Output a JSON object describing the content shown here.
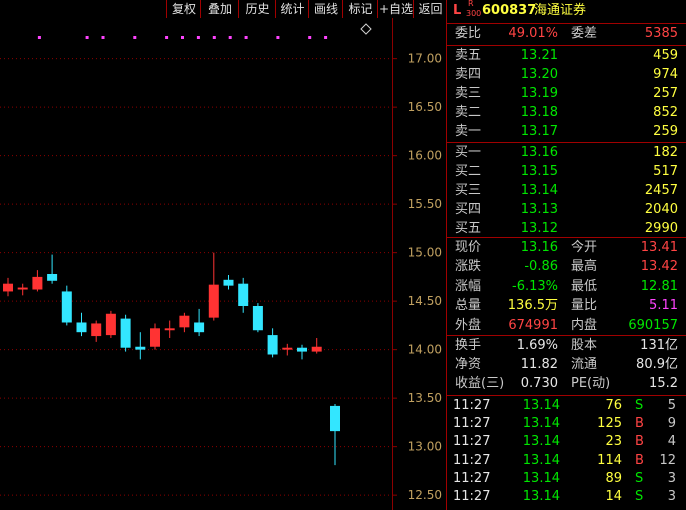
{
  "toolbar": [
    {
      "label": "复权",
      "name": "fuquan-button"
    },
    {
      "label": "叠加",
      "name": "overlay-button"
    },
    {
      "label": "历史",
      "name": "history-button"
    },
    {
      "label": "统计",
      "name": "stats-button"
    },
    {
      "label": "画线",
      "name": "draw-line-button"
    },
    {
      "label": "标记",
      "name": "mark-button"
    },
    {
      "label": "+自选",
      "name": "add-watchlist-button"
    },
    {
      "label": "返回",
      "name": "back-button"
    }
  ],
  "header": {
    "prefix": "L",
    "r_mark": "R",
    "r_sub": "300",
    "code": "600837",
    "name": "海通证券"
  },
  "weibi": {
    "label1": "委比",
    "value1": "49.01%",
    "label2": "委差",
    "value2": "5385"
  },
  "asks": [
    {
      "label": "卖五",
      "price": "13.21",
      "vol": "459"
    },
    {
      "label": "卖四",
      "price": "13.20",
      "vol": "974"
    },
    {
      "label": "卖三",
      "price": "13.19",
      "vol": "257"
    },
    {
      "label": "卖二",
      "price": "13.18",
      "vol": "852"
    },
    {
      "label": "卖一",
      "price": "13.17",
      "vol": "259"
    }
  ],
  "bids": [
    {
      "label": "买一",
      "price": "13.16",
      "vol": "182"
    },
    {
      "label": "买二",
      "price": "13.15",
      "vol": "517"
    },
    {
      "label": "买三",
      "price": "13.14",
      "vol": "2457"
    },
    {
      "label": "买四",
      "price": "13.13",
      "vol": "2040"
    },
    {
      "label": "买五",
      "price": "13.12",
      "vol": "2990"
    }
  ],
  "quote": [
    {
      "l1": "现价",
      "v1": "13.16",
      "c1": "green",
      "l2": "今开",
      "v2": "13.41",
      "c2": "red"
    },
    {
      "l1": "涨跌",
      "v1": "-0.86",
      "c1": "green",
      "l2": "最高",
      "v2": "13.42",
      "c2": "red"
    },
    {
      "l1": "涨幅",
      "v1": "-6.13%",
      "c1": "green",
      "l2": "最低",
      "v2": "12.81",
      "c2": "green"
    },
    {
      "l1": "总量",
      "v1": "136.5万",
      "c1": "yellow",
      "l2": "量比",
      "v2": "5.11",
      "c2": "mag"
    },
    {
      "l1": "外盘",
      "v1": "674991",
      "c1": "red",
      "l2": "内盘",
      "v2": "690157",
      "c2": "green"
    }
  ],
  "fundamentals": [
    {
      "l1": "换手",
      "v1": "1.69%",
      "l2": "股本",
      "v2": "131亿"
    },
    {
      "l1": "净资",
      "v1": "11.82",
      "l2": "流通",
      "v2": "80.9亿"
    },
    {
      "l1": "收益(三)",
      "v1": "0.730",
      "l2": "PE(动)",
      "v2": "15.2"
    }
  ],
  "ticks": [
    {
      "time": "11:27",
      "price": "13.14",
      "vol": "76",
      "side": "S",
      "count": "5"
    },
    {
      "time": "11:27",
      "price": "13.14",
      "vol": "125",
      "side": "B",
      "count": "9"
    },
    {
      "time": "11:27",
      "price": "13.14",
      "vol": "23",
      "side": "B",
      "count": "4"
    },
    {
      "time": "11:27",
      "price": "13.14",
      "vol": "114",
      "side": "B",
      "count": "12"
    },
    {
      "time": "11:27",
      "price": "13.14",
      "vol": "89",
      "side": "S",
      "count": "3"
    },
    {
      "time": "11:27",
      "price": "13.14",
      "vol": "14",
      "side": "S",
      "count": "3"
    }
  ],
  "colors": {
    "up": "#ff3333",
    "down": "#33e6ff",
    "grid": "#8b0000",
    "axis": "#c0a060",
    "marker": "#ff44ff"
  },
  "chart_data": {
    "type": "candlestick",
    "y_ticks": [
      "17.00",
      "16.50",
      "16.00",
      "15.50",
      "15.00",
      "14.50",
      "14.00",
      "13.50",
      "13.00",
      "12.50"
    ],
    "ylim": [
      12.45,
      17.45
    ],
    "candles": [
      {
        "o": 14.6,
        "h": 14.74,
        "l": 14.55,
        "c": 14.68
      },
      {
        "o": 14.62,
        "h": 14.68,
        "l": 14.56,
        "c": 14.64
      },
      {
        "o": 14.62,
        "h": 14.82,
        "l": 14.6,
        "c": 14.75
      },
      {
        "o": 14.78,
        "h": 14.98,
        "l": 14.68,
        "c": 14.71
      },
      {
        "o": 14.6,
        "h": 14.66,
        "l": 14.25,
        "c": 14.28
      },
      {
        "o": 14.28,
        "h": 14.38,
        "l": 14.14,
        "c": 14.18
      },
      {
        "o": 14.14,
        "h": 14.3,
        "l": 14.08,
        "c": 14.27
      },
      {
        "o": 14.15,
        "h": 14.4,
        "l": 14.12,
        "c": 14.37
      },
      {
        "o": 14.32,
        "h": 14.36,
        "l": 13.98,
        "c": 14.02
      },
      {
        "o": 14.03,
        "h": 14.18,
        "l": 13.9,
        "c": 14.0
      },
      {
        "o": 14.03,
        "h": 14.27,
        "l": 14.0,
        "c": 14.22
      },
      {
        "o": 14.2,
        "h": 14.3,
        "l": 14.12,
        "c": 14.22
      },
      {
        "o": 14.23,
        "h": 14.38,
        "l": 14.18,
        "c": 14.35
      },
      {
        "o": 14.28,
        "h": 14.42,
        "l": 14.14,
        "c": 14.18
      },
      {
        "o": 14.33,
        "h": 15.0,
        "l": 14.3,
        "c": 14.67
      },
      {
        "o": 14.72,
        "h": 14.77,
        "l": 14.62,
        "c": 14.66
      },
      {
        "o": 14.68,
        "h": 14.74,
        "l": 14.38,
        "c": 14.45
      },
      {
        "o": 14.45,
        "h": 14.48,
        "l": 14.18,
        "c": 14.2
      },
      {
        "o": 14.15,
        "h": 14.22,
        "l": 13.92,
        "c": 13.95
      },
      {
        "o": 14.0,
        "h": 14.06,
        "l": 13.94,
        "c": 14.02
      },
      {
        "o": 14.02,
        "h": 14.05,
        "l": 13.9,
        "c": 13.98
      },
      {
        "o": 13.98,
        "h": 14.12,
        "l": 13.96,
        "c": 14.03
      },
      {
        "o": 13.42,
        "h": 13.44,
        "l": 12.81,
        "c": 13.16
      }
    ],
    "marker_candles": [
      1,
      4,
      5,
      7,
      9,
      10,
      11,
      12,
      13,
      14,
      16,
      18,
      19
    ]
  }
}
